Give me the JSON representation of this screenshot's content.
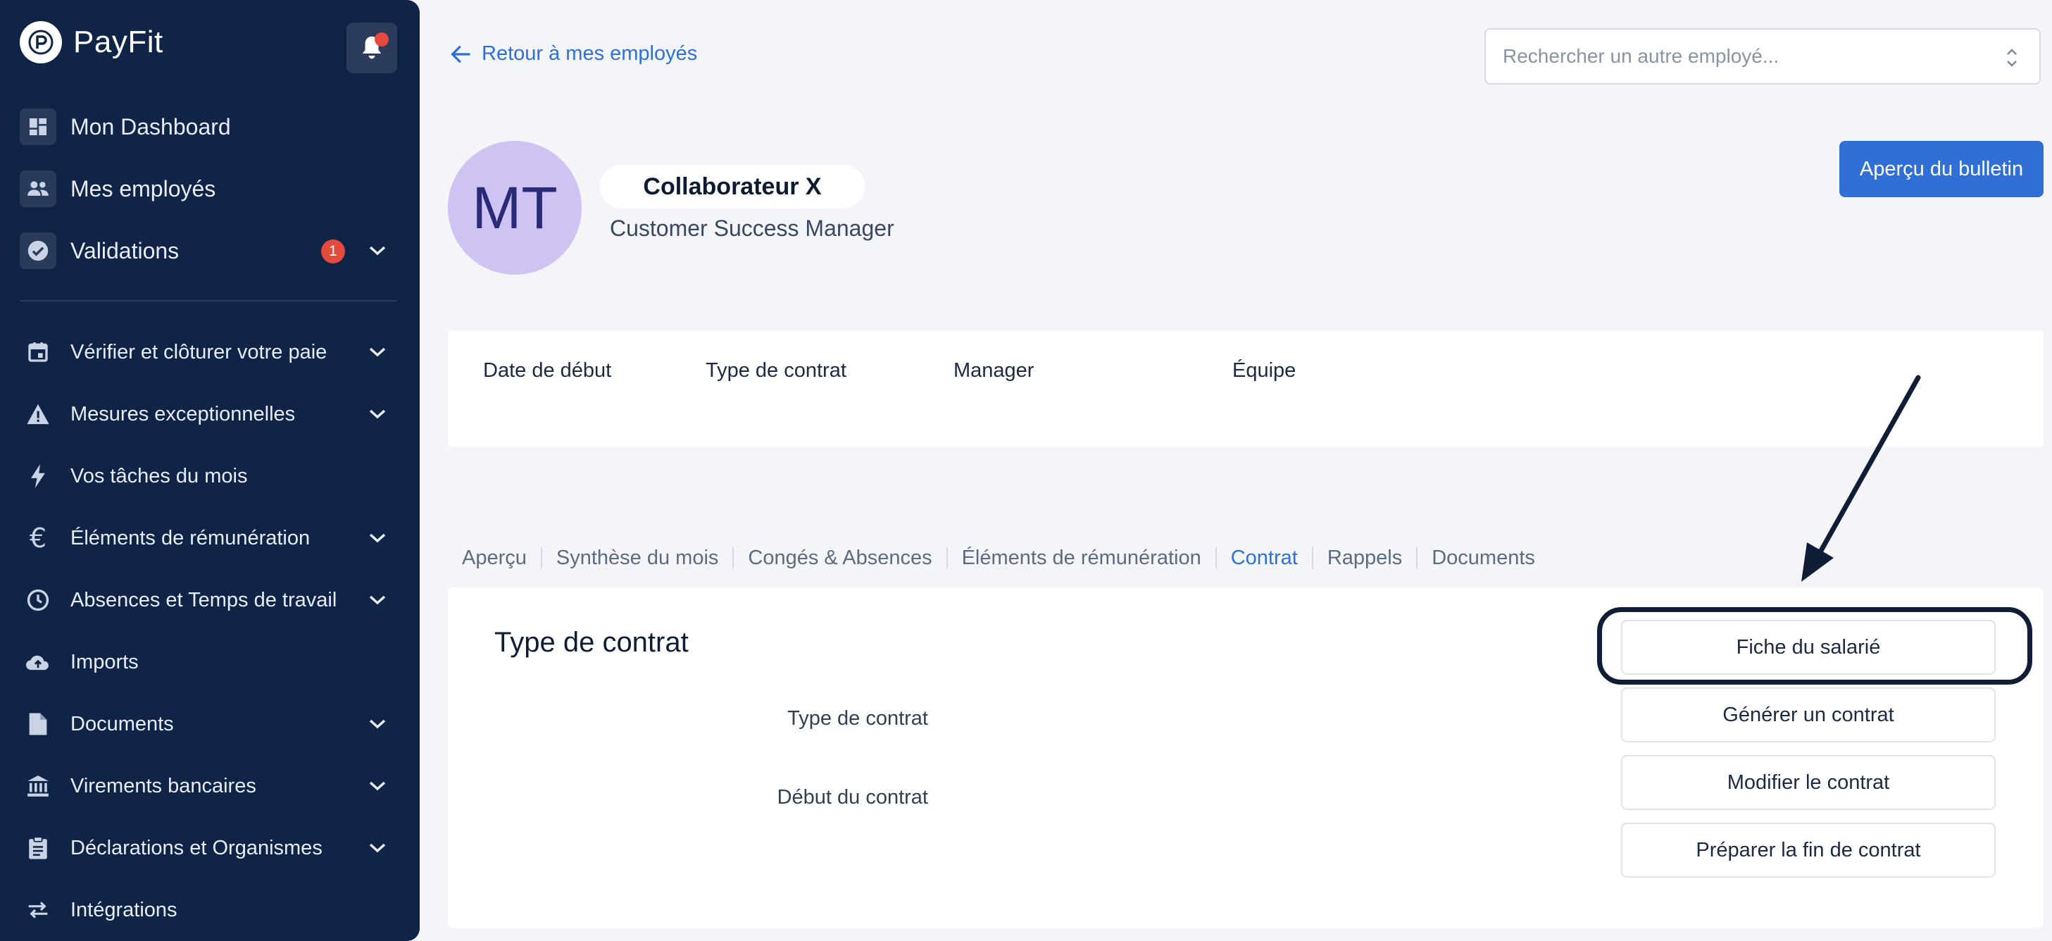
{
  "app": {
    "name": "PayFit"
  },
  "sidebar": {
    "items": [
      {
        "label": "Mon Dashboard",
        "icon": "dashboard-icon"
      },
      {
        "label": "Mes employés",
        "icon": "people-icon"
      },
      {
        "label": "Validations",
        "icon": "check-circle-icon",
        "badge": "1"
      },
      {
        "label": "Vérifier et clôturer votre paie",
        "icon": "calendar-icon"
      },
      {
        "label": "Mesures exceptionnelles",
        "icon": "warning-icon"
      },
      {
        "label": "Vos tâches du mois",
        "icon": "bolt-icon"
      },
      {
        "label": "Éléments de rémunération",
        "icon": "euro-icon"
      },
      {
        "label": "Absences et Temps de travail",
        "icon": "clock-icon"
      },
      {
        "label": "Imports",
        "icon": "cloud-upload-icon"
      },
      {
        "label": "Documents",
        "icon": "document-icon"
      },
      {
        "label": "Virements bancaires",
        "icon": "bank-icon"
      },
      {
        "label": "Déclarations et Organismes",
        "icon": "clipboard-icon"
      },
      {
        "label": "Intégrations",
        "icon": "swap-icon"
      }
    ]
  },
  "header": {
    "back_label": "Retour à mes employés",
    "search_placeholder": "Rechercher un autre employé..."
  },
  "employee": {
    "initials": "MT",
    "name": "Collaborateur X",
    "job_title": "Customer Success Manager",
    "preview_label": "Aperçu du bulletin"
  },
  "info": {
    "start_date_label": "Date de début",
    "contract_type_label": "Type de contrat",
    "manager_label": "Manager",
    "team_label": "Équipe"
  },
  "tabs": [
    {
      "label": "Aperçu"
    },
    {
      "label": "Synthèse du mois"
    },
    {
      "label": "Congés & Absences"
    },
    {
      "label": "Éléments de rémunération"
    },
    {
      "label": "Contrat",
      "active": true
    },
    {
      "label": "Rappels"
    },
    {
      "label": "Documents"
    }
  ],
  "contract": {
    "title": "Type de contrat",
    "fields": [
      {
        "label": "Type de contrat"
      },
      {
        "label": "Début du contrat"
      }
    ],
    "actions": [
      {
        "label": "Fiche du salarié"
      },
      {
        "label": "Générer un contrat"
      },
      {
        "label": "Modifier le contrat"
      },
      {
        "label": "Préparer la fin de contrat"
      }
    ]
  },
  "colors": {
    "sidebar_bg": "#0f2447",
    "accent": "#2f6fd6",
    "badge": "#e24a3b",
    "avatar_bg": "#cfc3f4"
  }
}
